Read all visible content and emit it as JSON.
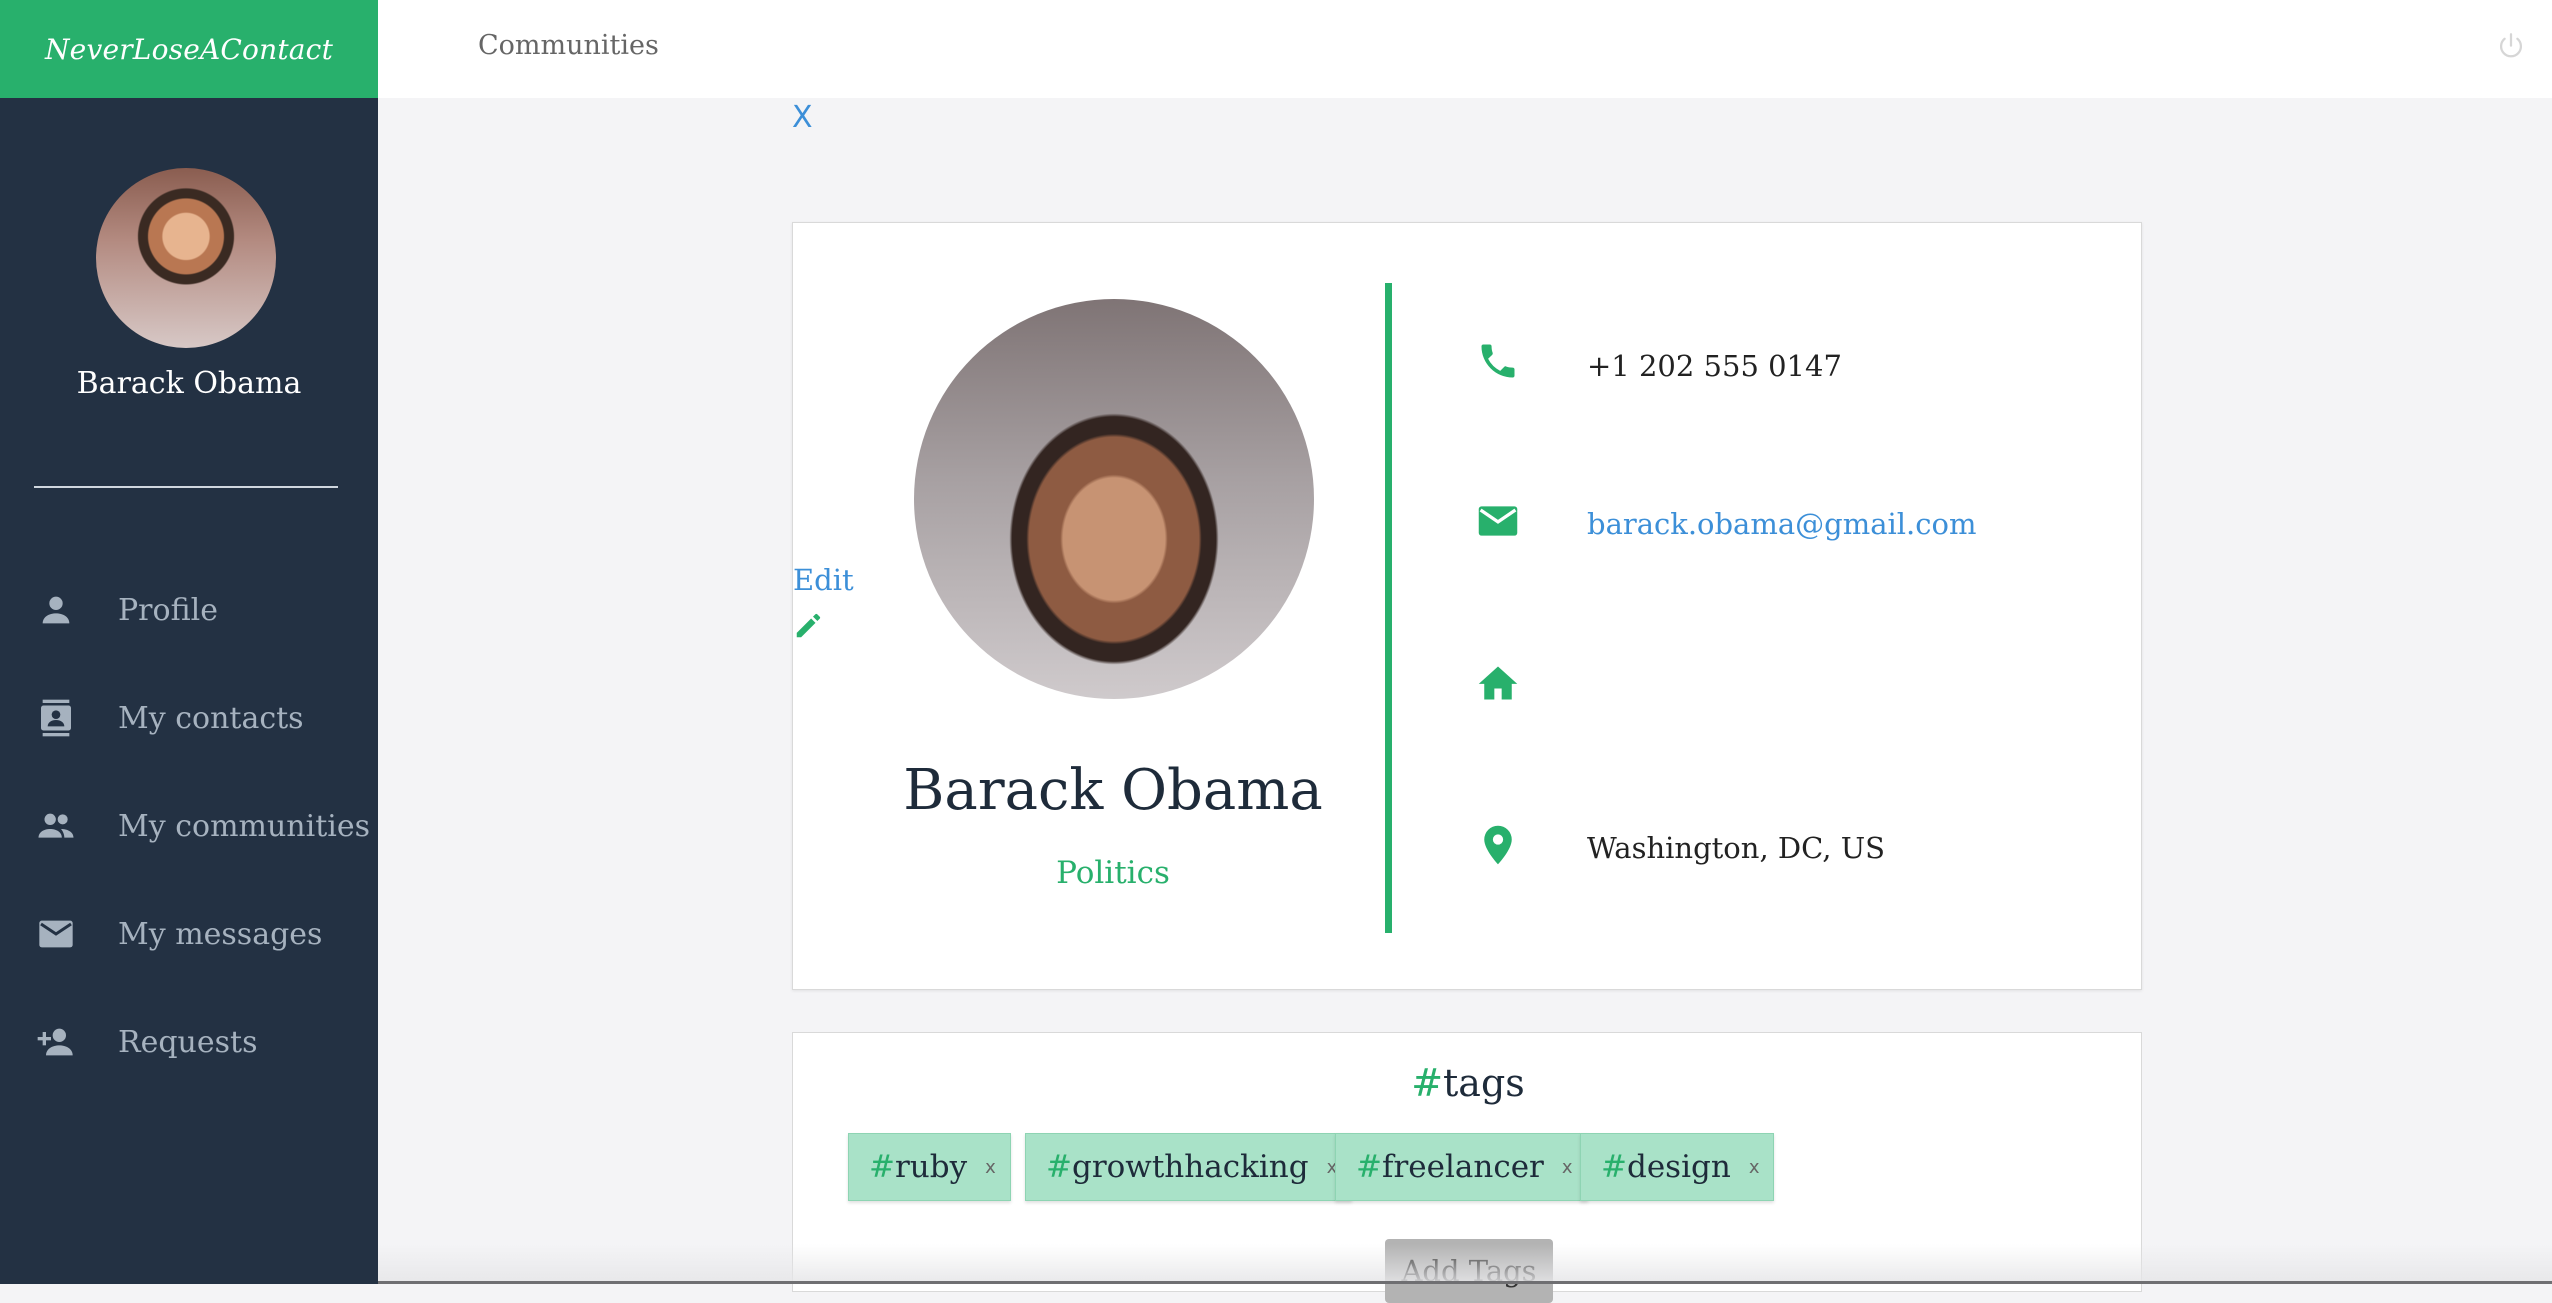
{
  "brand": {
    "title": "NeverLoseAContact"
  },
  "topbar": {
    "nav_link": "Communities",
    "power_icon": "power-icon"
  },
  "sidebar": {
    "user_name": "Barack Obama",
    "menu": [
      {
        "label": "Profile",
        "icon": "person-icon"
      },
      {
        "label": "My contacts",
        "icon": "contacts-icon"
      },
      {
        "label": "My communities",
        "icon": "group-icon"
      },
      {
        "label": "My messages",
        "icon": "mail-icon"
      },
      {
        "label": "Requests",
        "icon": "person-add-icon"
      }
    ]
  },
  "close_label": "X",
  "profile": {
    "edit_label": "Edit",
    "name": "Barack Obama",
    "role": "Politics",
    "phone": "+1 202 555 0147",
    "email": "barack.obama@gmail.com",
    "home": "",
    "location": "Washington, DC, US"
  },
  "tags": {
    "hash": "#",
    "title": "tags",
    "items": [
      "ruby",
      "growthhacking",
      "freelancer",
      "design"
    ],
    "remove_label": "x",
    "add_label": "Add Tags"
  },
  "colors": {
    "accent": "#28b06c",
    "sidebar": "#233143",
    "link": "#3c8fd8",
    "tag_bg": "#a9e2c8"
  }
}
